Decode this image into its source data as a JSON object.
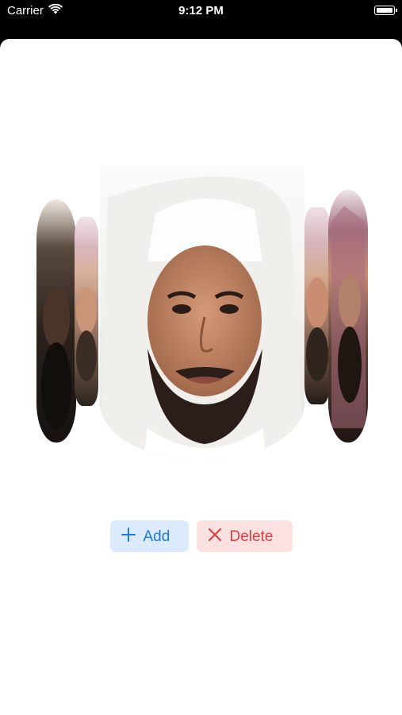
{
  "status_bar": {
    "carrier": "Carrier",
    "time": "9:12 PM",
    "icons": [
      "wifi-icon",
      "battery-icon"
    ]
  },
  "carousel": {
    "items": [
      {
        "name": "portrait-far-left"
      },
      {
        "name": "portrait-left"
      },
      {
        "name": "portrait-center"
      },
      {
        "name": "portrait-right"
      },
      {
        "name": "portrait-far-right"
      }
    ]
  },
  "actions": {
    "add_label": "Add",
    "add_icon": "plus-icon",
    "delete_label": "Delete",
    "delete_icon": "close-icon"
  },
  "colors": {
    "add_tint": "#1f7ae0",
    "add_background": "#dbeafc",
    "delete_tint": "#e23b3b",
    "delete_background": "#fde0e0"
  }
}
